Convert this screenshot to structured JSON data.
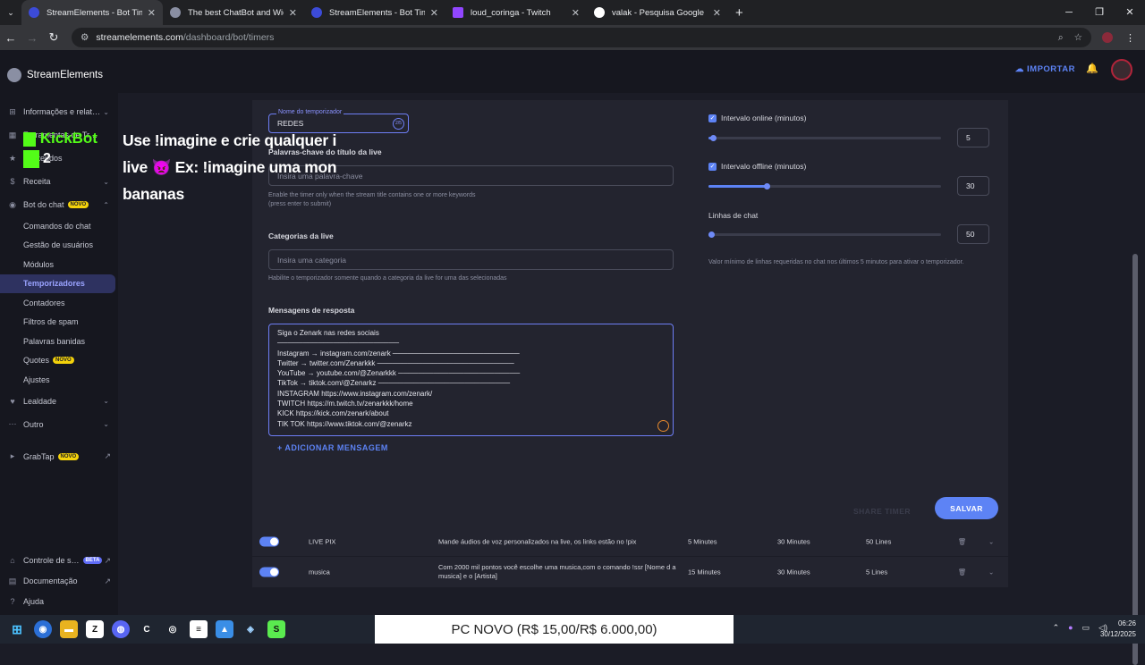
{
  "browser": {
    "tabs": [
      {
        "title": "StreamElements - Bot Timers",
        "color": "#3c4bd8",
        "active": true
      },
      {
        "title": "The best ChatBot and Widgets",
        "color": "#8a8fa3",
        "active": false
      },
      {
        "title": "StreamElements - Bot Timers",
        "color": "#3c4bd8",
        "active": false
      },
      {
        "title": "loud_coringa - Twitch",
        "color": "#9146ff",
        "active": false
      },
      {
        "title": "valak - Pesquisa Google",
        "color": "#ffffff",
        "active": false
      }
    ],
    "url_host": "streamelements.com",
    "url_path": "/dashboard/bot/timers"
  },
  "sidebar": {
    "brand": "StreamElements",
    "items": [
      {
        "label": "Informações e relat…"
      },
      {
        "label": "Ferramentas de Tr…"
      },
      {
        "label": "Conteúdos"
      },
      {
        "label": "Receita"
      },
      {
        "label": "Bot do chat",
        "badge": "NOVO"
      }
    ],
    "bot_sub": [
      "Comandos do chat",
      "Gestão de usuários",
      "Módulos",
      "Temporizadores",
      "Contadores",
      "Filtros de spam",
      "Palavras banidas",
      "Quotes",
      "Ajustes"
    ],
    "quotes_badge": "NOVO",
    "lealdade": "Lealdade",
    "outro": "Outro",
    "grabtap": "GrabTap",
    "grabtap_badge": "NOVO",
    "controle": "Controle de s…",
    "controle_badge": "BETA",
    "documentacao": "Documentação",
    "ajuda": "Ajuda"
  },
  "overlay": {
    "kick_name": "KickBot",
    "kick_count": "2",
    "message_line1": "Use !imagine e crie qualquer i",
    "message_line2": "live 👿 Ex: !imagine uma mon",
    "message_line3": "bananas"
  },
  "topbar": {
    "import_label": "IMPORTAR"
  },
  "form": {
    "timer_name_label": "Nome do temporizador",
    "timer_name_value": "REDES",
    "timer_name_counter": "2/5",
    "keywords_title": "Palavras-chave do título da live",
    "keywords_placeholder": "Insira uma palavra-chave",
    "keywords_help": "Enable the timer only when the stream title contains one or more keywords (press enter to submit)",
    "categories_title": "Categorias da live",
    "categories_placeholder": "Insira uma categoria",
    "categories_help": "Habilite o temporizador somente quando a categoria da live for uma das selecionadas",
    "messages_title": "Mensagens de resposta",
    "messages_lines": [
      "Siga o Zenark nas redes sociais",
      "────────────────────────",
      "Instagram → instagram.com/zenark ─────────────────────────",
      "Twitter → twitter.com/Zenarkkk ───────────────────────────",
      "YouTube → youtube.com/@Zenarkkk ────────────────────────",
      "TikTok → tiktok.com/@Zenarkz ──────────────────────────",
      "INSTAGRAM https://www.instagram.com/zenark/",
      "TWITCH https://m.twitch.tv/zenarkkk/home",
      "KICK https://kick.com/zenark/about",
      "TIK TOK https://www.tiktok.com/@zenarkz"
    ],
    "add_message": "+ ADICIONAR MENSAGEM",
    "online_label": "Intervalo online (minutos)",
    "online_value": "5",
    "online_fraction": 0.02,
    "offline_label": "Intervalo offline (minutos)",
    "offline_value": "30",
    "offline_fraction": 0.25,
    "lines_label": "Linhas de chat",
    "lines_value": "50",
    "lines_fraction": 0.0,
    "lines_help": "Valor mínimo de linhas requeridas no chat nos últimos 5 minutos para ativar o temporizador.",
    "share_label": "SHARE TIMER",
    "save_label": "SALVAR"
  },
  "timers": [
    {
      "name": "LIVE PIX",
      "message": "Mande áudios de voz personalizados na live, os links estão no !pix",
      "online": "5 Minutes",
      "offline": "30 Minutes",
      "lines": "50 Lines"
    },
    {
      "name": "musica",
      "message": "Com 2000 mil pontos você escolhe uma musica,com o comando !ssr [Nome d a musica] e o [Artista]",
      "online": "15 Minutes",
      "offline": "30 Minutes",
      "lines": "5 Lines"
    }
  ],
  "taskbar": {
    "banner": "PC NOVO (R$ 15,00/R$ 6.000,00)",
    "time": "06:26",
    "date": "30/12/2025"
  }
}
